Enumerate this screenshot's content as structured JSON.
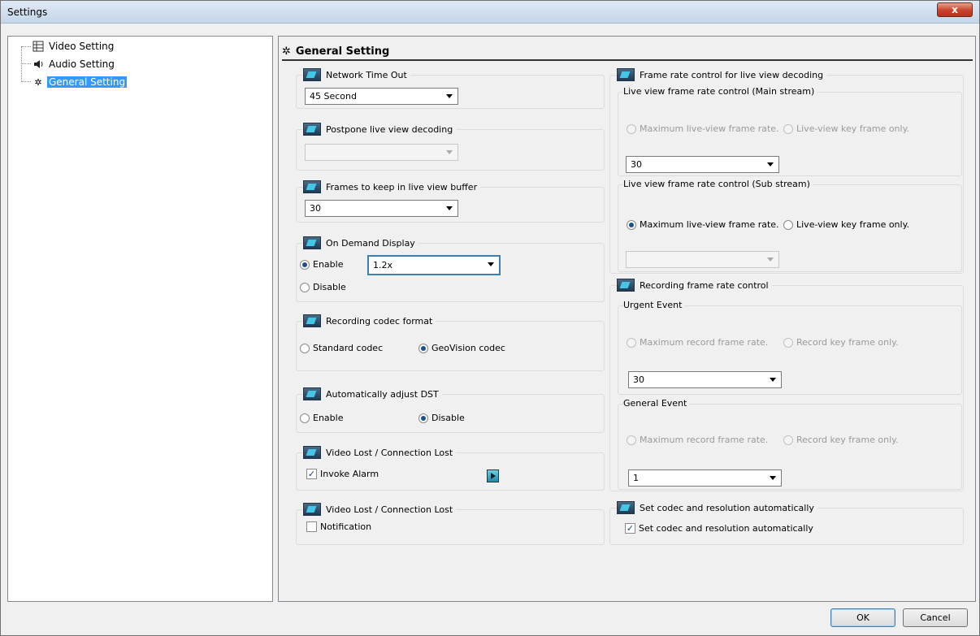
{
  "window": {
    "title": "Settings",
    "close_label": "x"
  },
  "tree": {
    "items": [
      {
        "label": "Video Setting",
        "icon": "film-icon"
      },
      {
        "label": "Audio Setting",
        "icon": "speaker-icon"
      },
      {
        "label": "General Setting",
        "icon": "gear-icon",
        "selected": true
      }
    ]
  },
  "header": {
    "title": "General Setting"
  },
  "network": {
    "title": "Network Time Out",
    "value": "45 Second"
  },
  "postpone": {
    "title": "Postpone live view decoding",
    "value": ""
  },
  "frames_buffer": {
    "title": "Frames to keep in live view buffer",
    "value": "30"
  },
  "on_demand": {
    "title": "On Demand Display",
    "enable": "Enable",
    "disable": "Disable",
    "value": "1.2x",
    "selected": "Enable"
  },
  "codec": {
    "title": "Recording codec format",
    "standard": "Standard codec",
    "geovision": "GeoVision codec",
    "selected": "GeoVision codec"
  },
  "dst": {
    "title": "Automatically adjust DST",
    "enable": "Enable",
    "disable": "Disable",
    "selected": "Disable"
  },
  "video_lost_1": {
    "title": "Video Lost / Connection Lost",
    "checkbox": "Invoke Alarm",
    "checked": true
  },
  "video_lost_2": {
    "title": "Video Lost / Connection Lost",
    "checkbox": "Notification",
    "checked": false
  },
  "live_frame": {
    "title": "Frame rate control for live view decoding",
    "main": {
      "title": "Live view frame rate control (Main stream)",
      "max": "Maximum live-view frame rate.",
      "key": "Live-view key frame only.",
      "value": "30"
    },
    "sub": {
      "title": "Live view frame rate control (Sub stream)",
      "max": "Maximum live-view frame rate.",
      "key": "Live-view key frame only.",
      "value": "",
      "selected": "max"
    }
  },
  "record_frame": {
    "title": "Recording frame rate control",
    "urgent": {
      "title": "Urgent Event",
      "max": "Maximum record frame rate.",
      "key": "Record key frame only.",
      "value": "30"
    },
    "general": {
      "title": "General Event",
      "max": "Maximum record frame rate.",
      "key": "Record key frame only.",
      "value": "1"
    }
  },
  "auto_codec": {
    "title": "Set codec and resolution automatically",
    "checkbox": "Set codec and resolution automatically",
    "checked": true
  },
  "buttons": {
    "ok": "OK",
    "cancel": "Cancel"
  }
}
